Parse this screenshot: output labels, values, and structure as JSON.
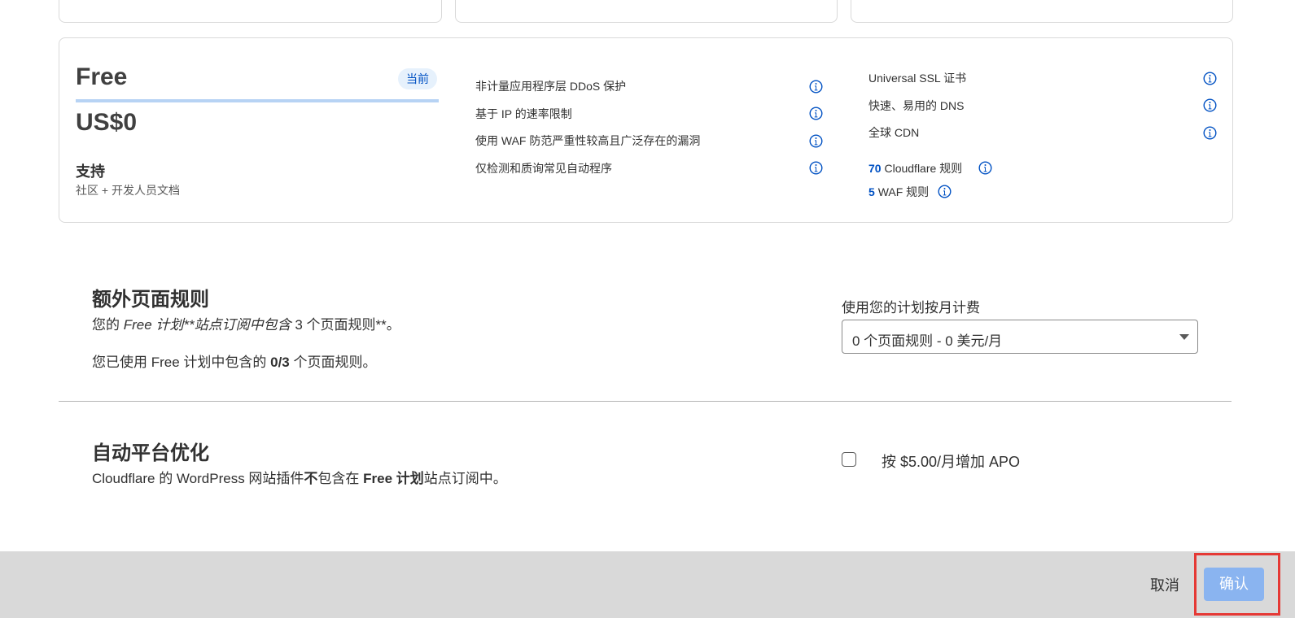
{
  "plan": {
    "name": "Free",
    "badge": "当前",
    "price": "US$0",
    "support_title": "支持",
    "support_desc": "社区 + 开发人员文档",
    "features_left": [
      "非计量应用程序层 DDoS 保护",
      "基于 IP 的速率限制",
      "使用 WAF 防范严重性较高且广泛存在的漏洞",
      "仅检测和质询常见自动程序"
    ],
    "features_right": [
      "Universal SSL 证书",
      "快速、易用的 DNS",
      "全球 CDN"
    ],
    "rules": [
      {
        "count": "70",
        "label": "Cloudflare 规则"
      },
      {
        "count": "5",
        "label": "WAF 规则"
      }
    ]
  },
  "page_rules": {
    "title": "额外页面规则",
    "line1_prefix": "您的 ",
    "line1_italic": "Free 计划**站点订阅中包含",
    "line1_suffix": " 3 个页面规则**。",
    "line2_prefix": "您已使用 Free 计划中包含的 ",
    "line2_bold": "0/3",
    "line2_suffix": " 个页面规则。",
    "select_label": "使用您的计划按月计费",
    "select_value": "0 个页面规则 - 0 美元/月"
  },
  "apo": {
    "title": "自动平台优化",
    "desc_prefix": "Cloudflare 的 WordPress 网站插件",
    "desc_bold1": "不",
    "desc_mid": "包含在 ",
    "desc_bold2": "Free 计划",
    "desc_suffix": "站点订阅中。",
    "checkbox_label": "按 $5.00/月增加 APO",
    "checked": false
  },
  "footer": {
    "cancel_label": "取消",
    "confirm_label": "确认"
  },
  "colors": {
    "accent": "#0051c3",
    "confirm_bg": "#8ab4f0",
    "highlight": "#e53935",
    "footer_bg": "#d9d9d9"
  }
}
